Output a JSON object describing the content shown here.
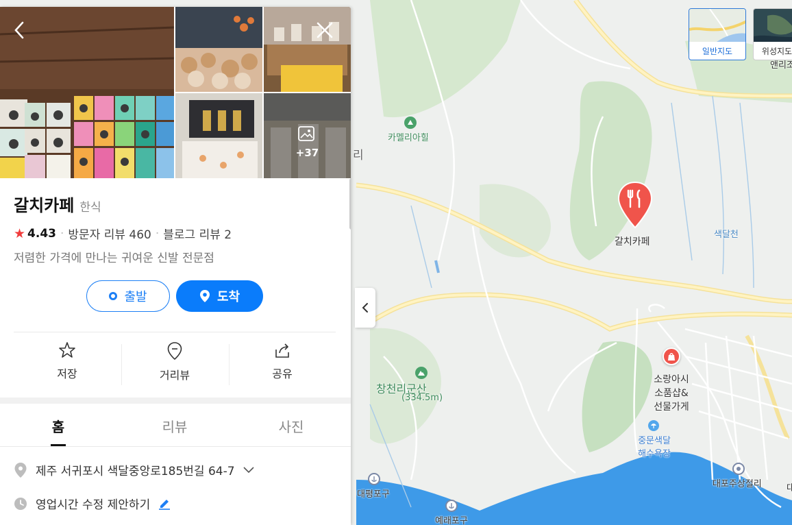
{
  "place": {
    "name": "갈치카페",
    "category": "한식",
    "rating": "4.43",
    "visitor_reviews": "방문자 리뷰 460",
    "blog_reviews": "블로그 리뷰 2",
    "description": "저렴한 가격에 만나는 귀여운 신발 전문점",
    "more_photos": "+37"
  },
  "buttons": {
    "start": "출발",
    "arrive": "도착"
  },
  "actions": {
    "save": "저장",
    "street_view": "거리뷰",
    "share": "공유"
  },
  "tabs": [
    {
      "label": "홈",
      "active": true
    },
    {
      "label": "리뷰",
      "active": false
    },
    {
      "label": "사진",
      "active": false
    }
  ],
  "info": {
    "address": "제주 서귀포시 색달중앙로185번길 64-7",
    "hours": "영업시간 수정 제안하기"
  },
  "map_types": {
    "normal": "일반지도",
    "satellite": "위성지도"
  },
  "map_labels": {
    "camellia_hill": "카멜리아힐",
    "ri": "리",
    "galchi_cafe": "갈치카페",
    "saekdal_stream": "색달천",
    "changcheon": "창천리군산",
    "changcheon_height": "(334.5m)",
    "sorang_line1": "소랑아시",
    "sorang_line2": "소품샵&",
    "sorang_line3": "선물가게",
    "jungmun_line1": "중문색달",
    "jungmun_line2": "해수욕장",
    "daepyeong": "대평포구",
    "yerae": "예래포구",
    "daepo": "대포주상절리",
    "anri": "앤리조",
    "da": "대"
  },
  "colors": {
    "accent": "#0a7cfb",
    "star": "#f03c3c",
    "restaurant_pin": "#f0544b",
    "sea": "#3e9ae8",
    "forest": "#cfe4c8"
  }
}
